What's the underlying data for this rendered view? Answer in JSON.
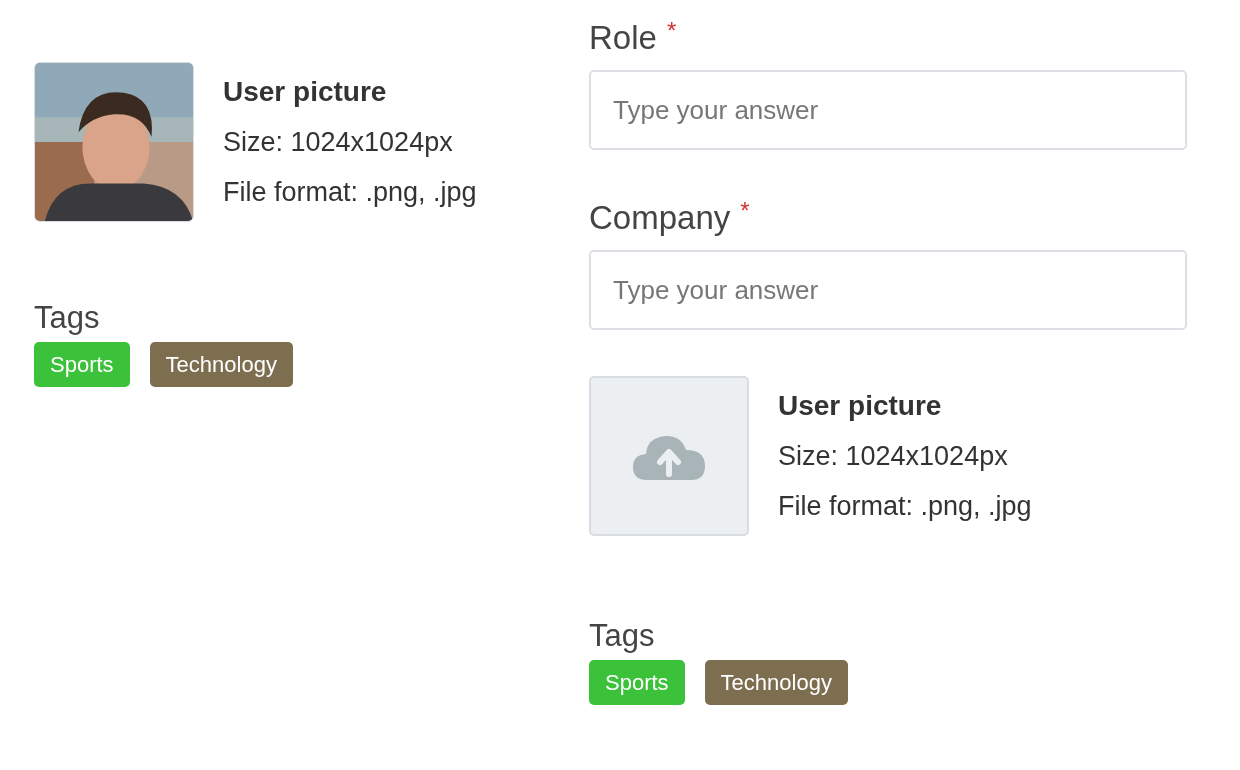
{
  "profile": {
    "title": "User picture",
    "size": "Size: 1024x1024px",
    "format": "File format: .png, .jpg",
    "tags_label": "Tags",
    "tags": [
      {
        "label": "Sports",
        "color": "#3cc13b"
      },
      {
        "label": "Technology",
        "color": "#7d6e50"
      }
    ]
  },
  "form": {
    "fields": [
      {
        "label": "Role",
        "required": true,
        "mark": "*",
        "placeholder": "Type your answer"
      },
      {
        "label": "Company",
        "required": true,
        "mark": "*",
        "placeholder": "Type your answer"
      }
    ],
    "upload": {
      "kind": "upload",
      "title": "User picture",
      "size": "Size: 1024x1024px",
      "format": "File format: .png, .jpg"
    },
    "tags_label": "Tags",
    "tags": [
      {
        "label": "Sports",
        "color": "#3cc13b"
      },
      {
        "label": "Technology",
        "color": "#7d6e50"
      }
    ]
  }
}
